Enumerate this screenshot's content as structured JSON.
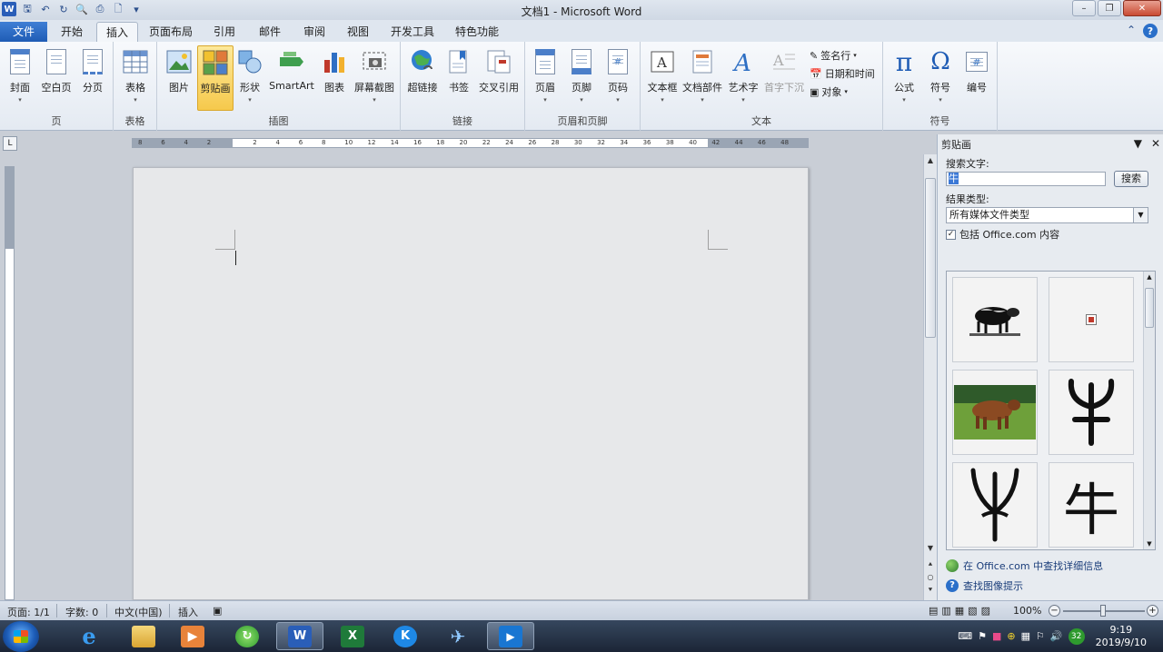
{
  "window": {
    "title": "文档1 - Microsoft Word"
  },
  "tabs": [
    {
      "label": "文件"
    },
    {
      "label": "开始"
    },
    {
      "label": "插入"
    },
    {
      "label": "页面布局"
    },
    {
      "label": "引用"
    },
    {
      "label": "邮件"
    },
    {
      "label": "审阅"
    },
    {
      "label": "视图"
    },
    {
      "label": "开发工具"
    },
    {
      "label": "特色功能"
    }
  ],
  "ribbon": {
    "groups": {
      "page": "页",
      "table": "表格",
      "illustrations": "插图",
      "links": "链接",
      "header_footer": "页眉和页脚",
      "text": "文本",
      "symbols": "符号"
    },
    "buttons": {
      "cover": "封面",
      "blank_page": "空白页",
      "page_break": "分页",
      "table": "表格",
      "picture": "图片",
      "clip_art": "剪贴画",
      "shapes": "形状",
      "smartart": "SmartArt",
      "chart": "图表",
      "screenshot": "屏幕截图",
      "hyperlink": "超链接",
      "bookmark": "书签",
      "cross_ref": "交叉引用",
      "header": "页眉",
      "footer": "页脚",
      "page_number": "页码",
      "text_box": "文本框",
      "quick_parts": "文档部件",
      "wordart": "艺术字",
      "drop_cap": "首字下沉",
      "signature_line": "签名行",
      "date_time": "日期和时间",
      "object": "对象",
      "equation": "公式",
      "symbol": "符号",
      "number": "编号"
    }
  },
  "ruler": {
    "ticks": [
      "8",
      "6",
      "4",
      "2",
      "",
      "2",
      "4",
      "6",
      "8",
      "10",
      "12",
      "14",
      "16",
      "18",
      "20",
      "22",
      "24",
      "26",
      "28",
      "30",
      "32",
      "34",
      "36",
      "38",
      "40",
      "42",
      "44",
      "46",
      "48"
    ]
  },
  "clipart_pane": {
    "title": "剪贴画",
    "search_label": "搜索文字:",
    "search_value": "牛",
    "search_button": "搜索",
    "results_label": "结果类型:",
    "results_value": "所有媒体文件类型",
    "include_office": "包括 Office.com 内容",
    "include_checked": true,
    "link_more": "在 Office.com 中查找详细信息",
    "link_tips": "查找图像提示",
    "results": [
      {
        "kind": "cow-drawing-clipart"
      },
      {
        "kind": "missing-image-placeholder"
      },
      {
        "kind": "cow-photo"
      },
      {
        "kind": "oracle-bone-niu-glyph"
      },
      {
        "kind": "ancient-niu-glyph"
      },
      {
        "kind": "niu-character",
        "text": "牛"
      }
    ]
  },
  "statusbar": {
    "page": "页面: 1/1",
    "words": "字数: 0",
    "language": "中文(中国)",
    "mode": "插入",
    "zoom": "100%"
  },
  "taskbar": {
    "time": "9:19",
    "date": "2019/9/10",
    "tray_badge": "32"
  }
}
